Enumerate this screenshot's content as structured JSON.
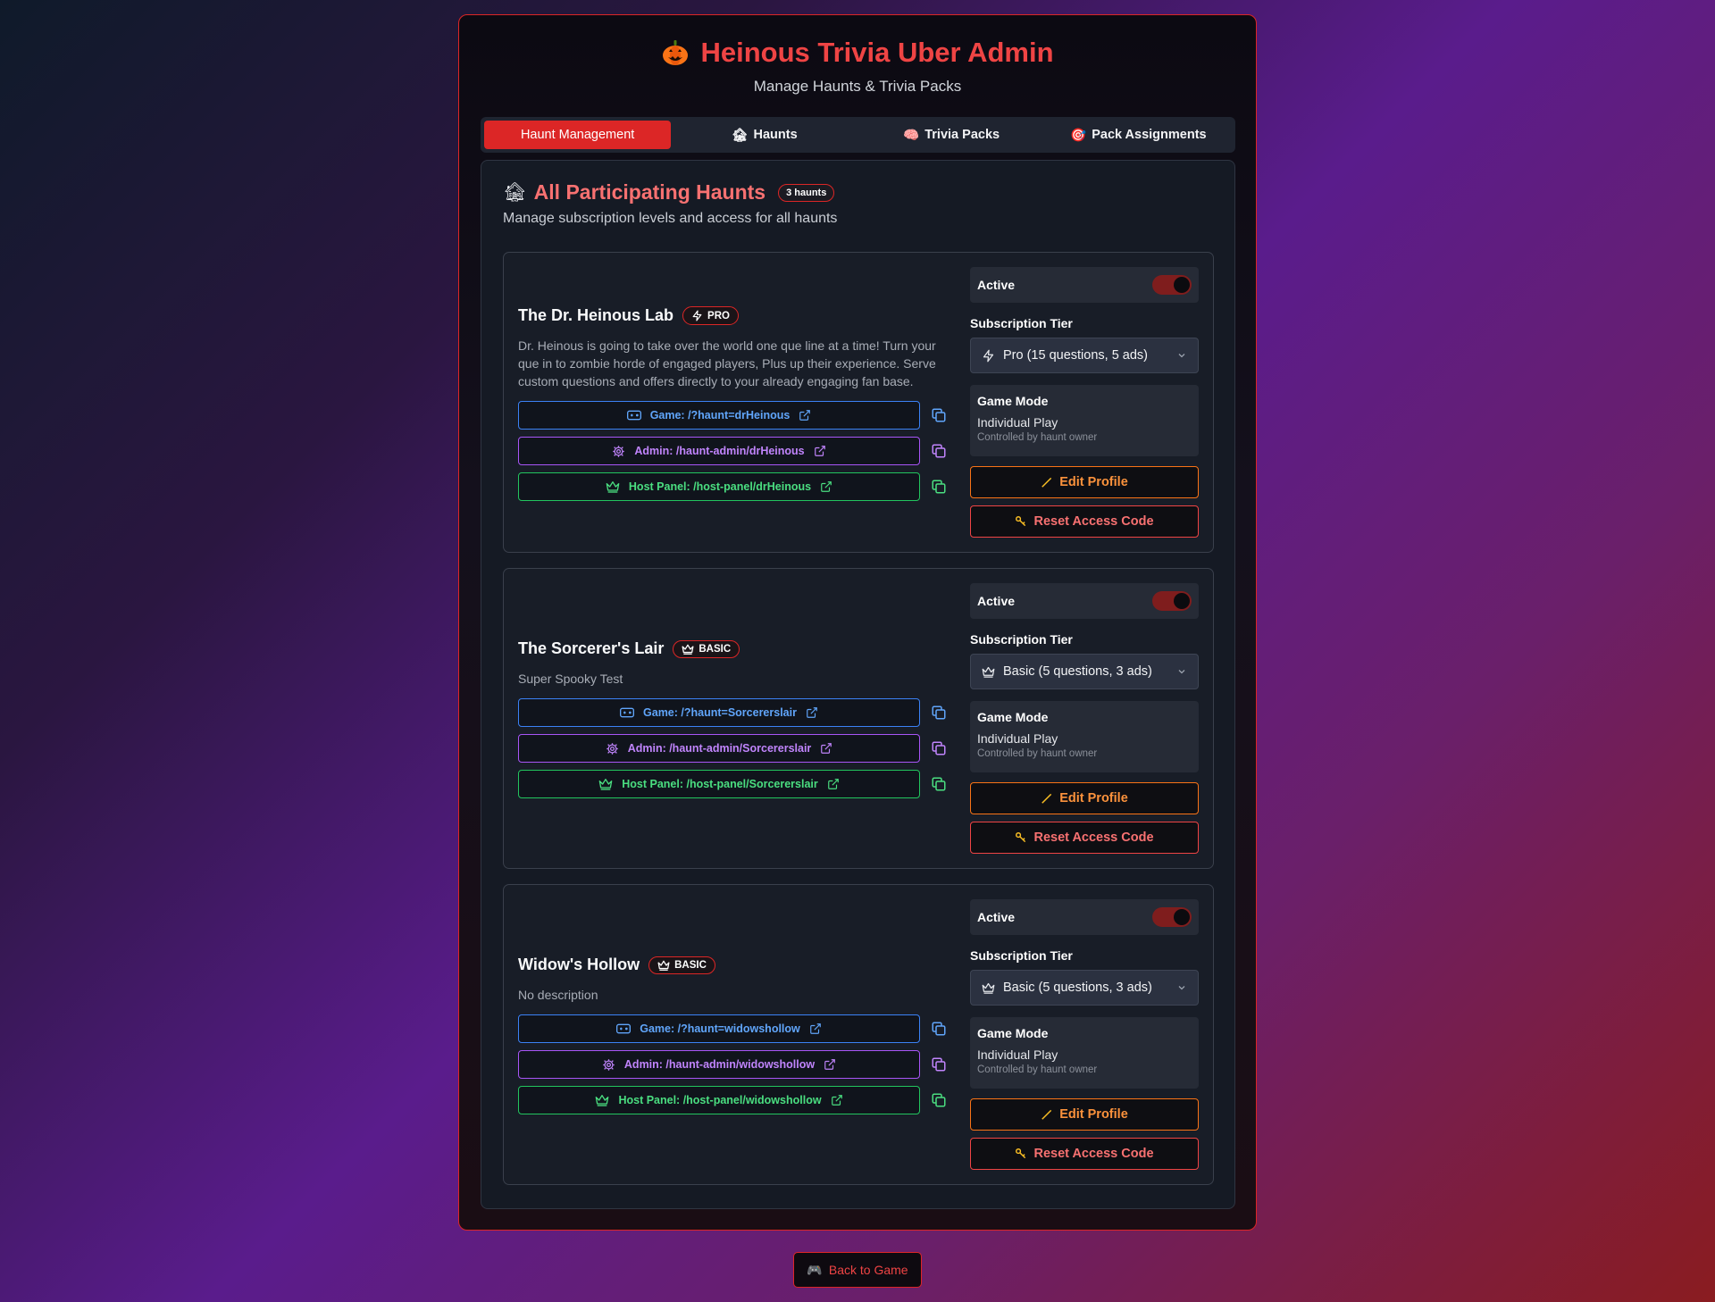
{
  "header": {
    "title": "Heinous Trivia Uber Admin",
    "subtitle": "Manage Haunts & Trivia Packs"
  },
  "tabs": [
    {
      "label": "Haunt Management",
      "icon": ""
    },
    {
      "label": "Haunts",
      "icon": "🏚"
    },
    {
      "label": "Trivia Packs",
      "icon": "🧠"
    },
    {
      "label": "Pack Assignments",
      "icon": "🎯"
    }
  ],
  "section": {
    "icon": "🏚",
    "title": "All Participating Haunts",
    "count": "3 haunts",
    "description": "Manage subscription levels and access for all haunts"
  },
  "haunts": [
    {
      "name": "The Dr. Heinous Lab",
      "tier_badge": "PRO",
      "tier_icon": "bolt-icon",
      "description": "Dr. Heinous is going to take over the world one que line at a time! Turn your que in to zombie horde of engaged players, Plus up their experience. Serve custom questions and offers directly to your already engaging fan base.",
      "game_link": "Game: /?haunt=drHeinous",
      "admin_link": "Admin: /haunt-admin/drHeinous",
      "host_link": "Host Panel: /host-panel/drHeinous",
      "active_label": "Active",
      "subscription_label": "Subscription Tier",
      "subscription_value": "Pro (15 questions, 5 ads)",
      "game_mode_label": "Game Mode",
      "game_mode_value": "Individual Play",
      "game_mode_note": "Controlled by haunt owner",
      "edit_label": "Edit Profile",
      "reset_label": "Reset Access Code"
    },
    {
      "name": "The Sorcerer's Lair",
      "tier_badge": "BASIC",
      "tier_icon": "crown-icon",
      "description": "Super Spooky Test",
      "game_link": "Game: /?haunt=Sorcererslair",
      "admin_link": "Admin: /haunt-admin/Sorcererslair",
      "host_link": "Host Panel: /host-panel/Sorcererslair",
      "active_label": "Active",
      "subscription_label": "Subscription Tier",
      "subscription_value": "Basic (5 questions, 3 ads)",
      "game_mode_label": "Game Mode",
      "game_mode_value": "Individual Play",
      "game_mode_note": "Controlled by haunt owner",
      "edit_label": "Edit Profile",
      "reset_label": "Reset Access Code"
    },
    {
      "name": "Widow's Hollow",
      "tier_badge": "BASIC",
      "tier_icon": "crown-icon",
      "description": "No description",
      "game_link": "Game: /?haunt=widowshollow",
      "admin_link": "Admin: /haunt-admin/widowshollow",
      "host_link": "Host Panel: /host-panel/widowshollow",
      "active_label": "Active",
      "subscription_label": "Subscription Tier",
      "subscription_value": "Basic (5 questions, 3 ads)",
      "game_mode_label": "Game Mode",
      "game_mode_value": "Individual Play",
      "game_mode_note": "Controlled by haunt owner",
      "edit_label": "Edit Profile",
      "reset_label": "Reset Access Code"
    }
  ],
  "footer": {
    "back_label": "Back to Game",
    "back_icon": "🎮"
  },
  "colors": {
    "accent": "#dc2626",
    "game_link": "#60a5fa",
    "admin_link": "#c084fc",
    "host_link": "#4ade80",
    "edit": "#fb923c"
  }
}
